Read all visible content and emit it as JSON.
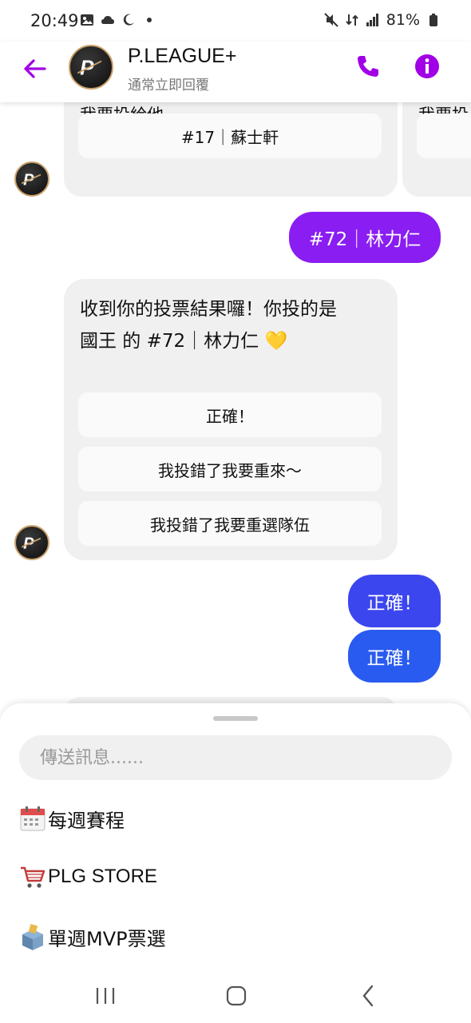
{
  "status_bar": {
    "time": "20:49",
    "battery": "81%",
    "left_icons": [
      "image-icon",
      "cloud-icon",
      "moon-icon",
      "dot-icon"
    ],
    "right_icons": [
      "mute-icon",
      "data-icon",
      "signal-icon",
      "battery-icon"
    ]
  },
  "header": {
    "title": "P.LEAGUE+",
    "subtitle": "通常立即回覆",
    "accent_color": "#a100e6"
  },
  "messages": {
    "card1": {
      "text": "我要投給他",
      "option": "#17｜蘇士軒"
    },
    "card2": {
      "text": "我要投"
    },
    "user_reply_1": "#72｜林力仁",
    "bot_message": {
      "text_line1": "收到你的投票結果囉！你投的是",
      "text_line2": "國王 的 #72｜林力仁 💛",
      "options": [
        "正確！",
        "我投錯了我要重來～",
        "我投錯了我要重選隊伍"
      ]
    },
    "user_reply_2": "正確！",
    "user_reply_3": "正確！",
    "colors": {
      "purple_bubble": "#8a1df2",
      "blue_bubble_1": "#3c46ee",
      "blue_bubble_2": "#2a5bf0"
    }
  },
  "composer": {
    "placeholder": "傳送訊息......"
  },
  "menu": {
    "items": [
      {
        "icon": "calendar-icon",
        "label": "每週賽程"
      },
      {
        "icon": "cart-icon",
        "label": "PLG STORE"
      },
      {
        "icon": "ballot-box-icon",
        "label": "單週MVP票選"
      }
    ]
  },
  "nav": {
    "buttons": [
      "recent-apps-icon",
      "home-icon",
      "back-icon"
    ]
  }
}
